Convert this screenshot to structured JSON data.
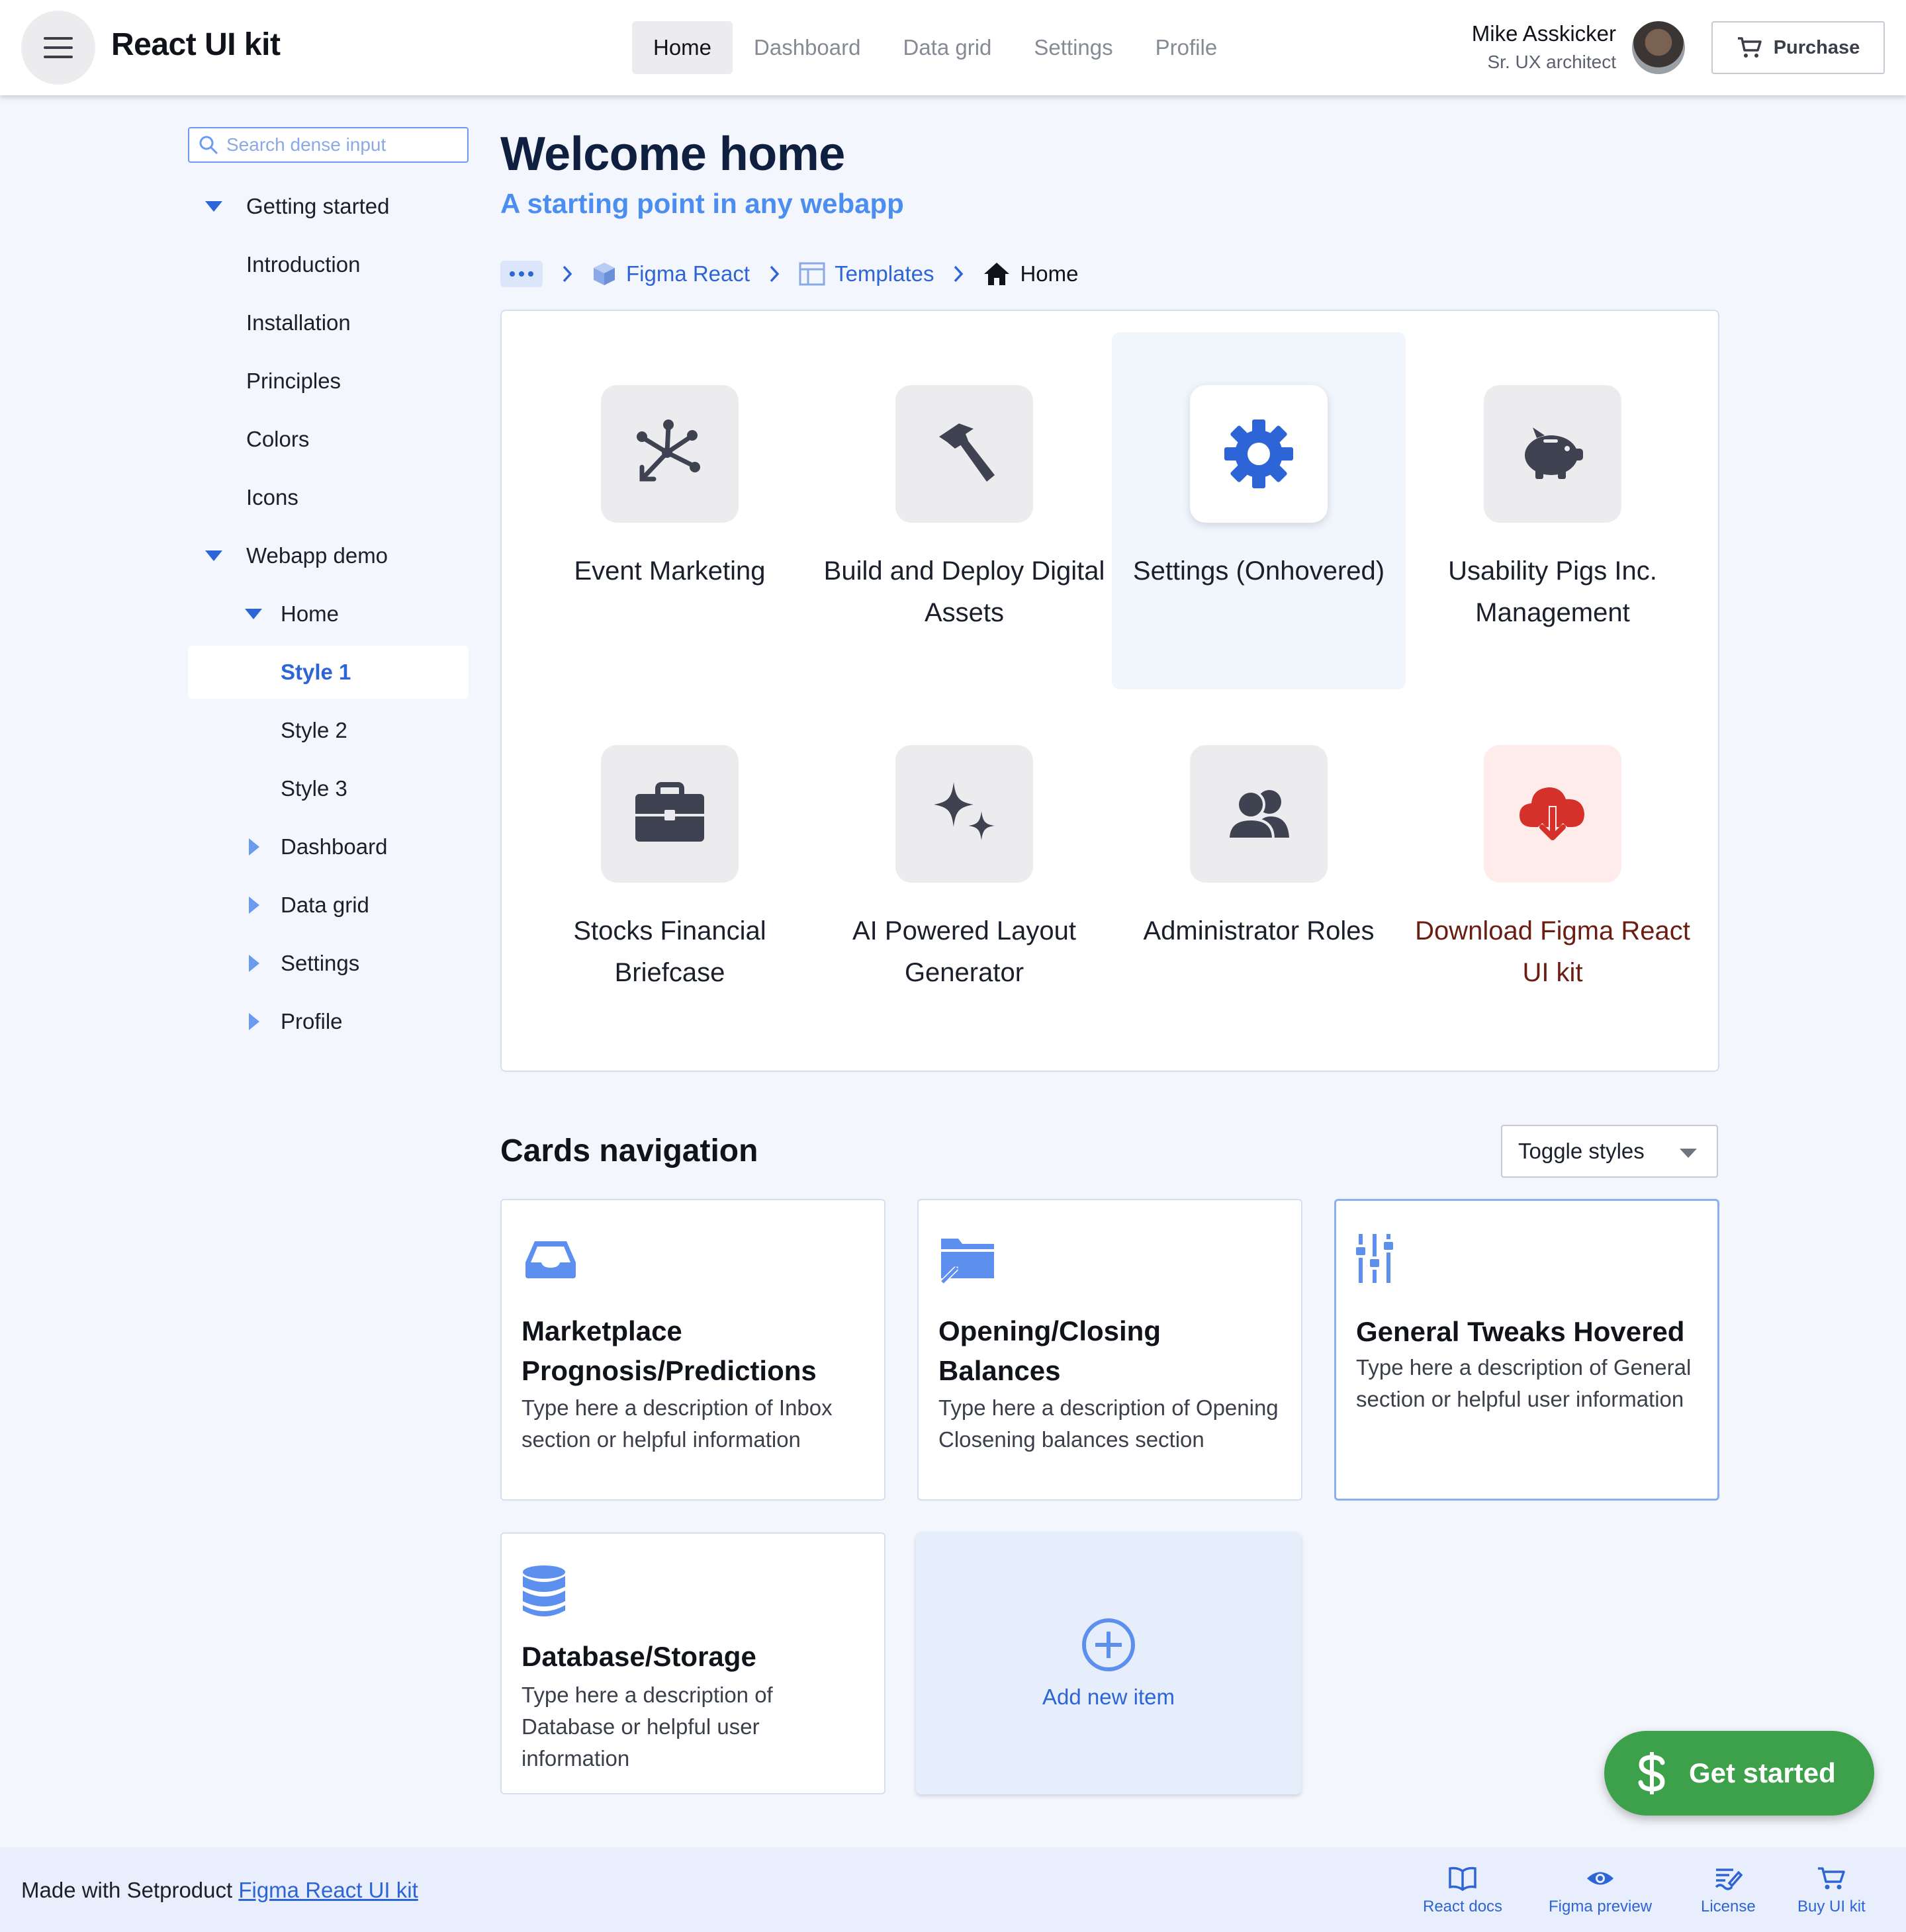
{
  "header": {
    "app_title": "React UI kit",
    "nav_tabs": [
      "Home",
      "Dashboard",
      "Data grid",
      "Settings",
      "Profile"
    ],
    "active_tab": "Home",
    "user_name": "Mike Asskicker",
    "user_role": "Sr. UX architect",
    "purchase_label": "Purchase"
  },
  "sidebar": {
    "search_placeholder": "Search dense input",
    "items": [
      {
        "label": "Getting started",
        "expander": "down"
      },
      {
        "label": "Introduction"
      },
      {
        "label": "Installation"
      },
      {
        "label": "Principles"
      },
      {
        "label": "Colors"
      },
      {
        "label": "Icons"
      },
      {
        "label": "Webapp demo",
        "expander": "down"
      },
      {
        "label": "Home",
        "expander": "down"
      },
      {
        "label": "Style 1",
        "selected": true
      },
      {
        "label": "Style 2"
      },
      {
        "label": "Style 3"
      },
      {
        "label": "Dashboard",
        "expander": "right"
      },
      {
        "label": "Data grid",
        "expander": "right"
      },
      {
        "label": "Settings",
        "expander": "right"
      },
      {
        "label": "Profile",
        "expander": "right"
      }
    ]
  },
  "main": {
    "title": "Welcome home",
    "subtitle": "A starting point in any webapp",
    "breadcrumb": [
      "Figma React",
      "Templates",
      "Home"
    ],
    "tiles": [
      {
        "label": "Event Marketing",
        "icon": "network-icon"
      },
      {
        "label": "Build and Deploy Digital Assets",
        "icon": "hammer-icon"
      },
      {
        "label": "Settings (Onhovered)",
        "icon": "gear-icon"
      },
      {
        "label": "Usability Pigs Inc. Management",
        "icon": "piggy-bank-icon"
      },
      {
        "label": "Stocks Financial Briefcase",
        "icon": "briefcase-icon"
      },
      {
        "label": "AI Powered Layout Generator",
        "icon": "sparkles-icon"
      },
      {
        "label": "Administrator Roles",
        "icon": "users-icon"
      },
      {
        "label": "Download Figma React UI kit",
        "icon": "cloud-download-icon"
      }
    ],
    "cards_title": "Cards navigation",
    "toggle_label": "Toggle styles",
    "cards": [
      {
        "title": "Marketplace Prognosis/Predictions",
        "desc": "Type here a description of Inbox section or helpful information",
        "icon": "inbox-icon"
      },
      {
        "title": "Opening/Closing Balances",
        "desc": "Type here a description of Opening Closening balances section",
        "icon": "folder-icon"
      },
      {
        "title": "General Tweaks Hovered",
        "desc": "Type here a description of General section or helpful user information",
        "icon": "sliders-icon"
      },
      {
        "title": "Database/Storage",
        "desc": "Type here a description of Database or helpful user information",
        "icon": "database-icon"
      }
    ],
    "add_label": "Add new item",
    "fab_label": "Get started"
  },
  "footer": {
    "made_with": "Made with Setproduct",
    "link_text": "Figma React UI kit",
    "links": [
      "React docs",
      "Figma preview",
      "License",
      "Buy UI kit"
    ]
  },
  "colors": {
    "accent": "#2d64d6",
    "success": "#3da04a",
    "danger": "#d6302a"
  }
}
